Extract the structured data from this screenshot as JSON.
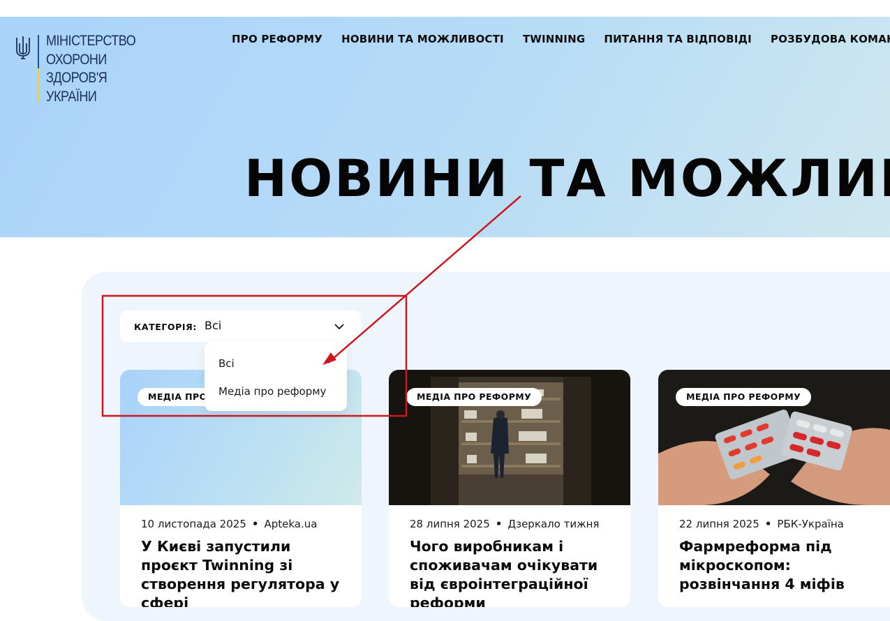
{
  "header": {
    "logo_lines": [
      "МІНІСТЕРСТВО",
      "ОХОРОНИ",
      "ЗДОРОВ'Я",
      "УКРАЇНИ"
    ],
    "nav": [
      {
        "label": "ПРО РЕФОРМУ"
      },
      {
        "label": "НОВИНИ ТА МОЖЛИВОСТІ"
      },
      {
        "label": "TWINNING"
      },
      {
        "label": "ПИТАННЯ ТА ВІДПОВІДІ"
      },
      {
        "label": "РОЗБУДОВА КОМАНДИ"
      }
    ]
  },
  "hero": {
    "title": "НОВИНИ ТА МОЖЛИВОСТІ"
  },
  "filter": {
    "label": "КАТЕГОРІЯ:",
    "selected": "Всі",
    "options": [
      "Всі",
      "Медіа про реформу"
    ]
  },
  "cards": [
    {
      "badge": "МЕДІА ПРО РЕФОРМУ",
      "date": "10 листопада 2025",
      "source": "Apteka.ua",
      "title": "У Києві запустили проєкт Twinning зі створення регулятора у сфері"
    },
    {
      "badge": "МЕДІА ПРО РЕФОРМУ",
      "date": "28 липня 2025",
      "source": "Дзеркало тижня",
      "title": "Чого виробникам і споживачам очікувати від євроінтеграційної реформи"
    },
    {
      "badge": "МЕДІА ПРО РЕФОРМУ",
      "date": "22 липня 2025",
      "source": "РБК-Україна",
      "title": "Фармреформа під мікроскопом: розвінчання 4 міфів"
    }
  ],
  "colors": {
    "annotation": "#d0151b",
    "panel": "#eef5fd",
    "logo_blue": "#1f4f8f",
    "logo_yellow": "#f2cf2a"
  }
}
